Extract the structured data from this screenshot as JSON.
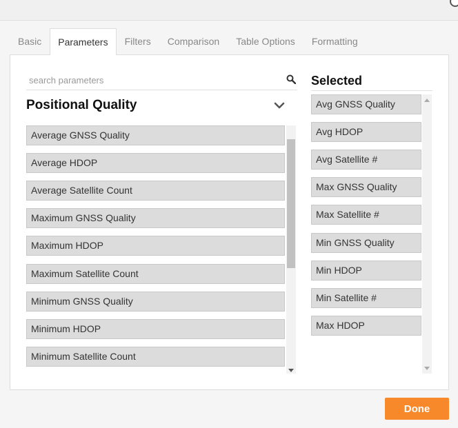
{
  "tabs": [
    {
      "label": "Basic",
      "active": false
    },
    {
      "label": "Parameters",
      "active": true
    },
    {
      "label": "Filters",
      "active": false
    },
    {
      "label": "Comparison",
      "active": false
    },
    {
      "label": "Table Options",
      "active": false
    },
    {
      "label": "Formatting",
      "active": false
    }
  ],
  "search": {
    "placeholder": "search parameters",
    "value": ""
  },
  "group": {
    "title": "Positional Quality"
  },
  "parameters": [
    "Average GNSS Quality",
    "Average HDOP",
    "Average Satellite Count",
    "Maximum GNSS Quality",
    "Maximum HDOP",
    "Maximum Satellite Count",
    "Minimum GNSS Quality",
    "Minimum HDOP",
    "Minimum Satellite Count"
  ],
  "selected": {
    "title": "Selected",
    "items": [
      "Avg GNSS Quality",
      "Avg HDOP",
      "Avg Satellite #",
      "Max GNSS Quality",
      "Max Satellite #",
      "Min GNSS Quality",
      "Min HDOP",
      "Min Satellite #",
      "Max HDOP"
    ]
  },
  "footer": {
    "done_label": "Done"
  },
  "colors": {
    "accent": "#f7892b",
    "item_bg": "#dcdcdc"
  }
}
